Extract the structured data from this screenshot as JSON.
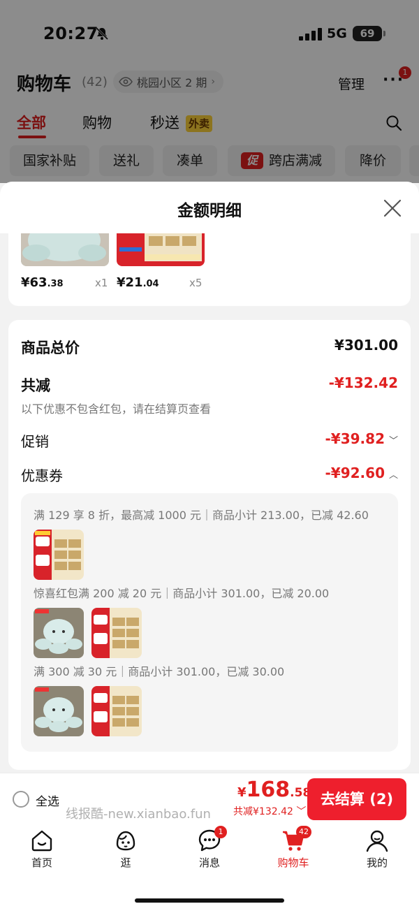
{
  "status": {
    "time": "20:27",
    "network": "5G",
    "battery": "69"
  },
  "header": {
    "title": "购物车",
    "count": "(42)",
    "location": "桃园小区 2 期",
    "manage": "管理",
    "more_badge": "1"
  },
  "tabs": [
    "全部",
    "购物",
    "秒送"
  ],
  "waimai_tag": "外卖",
  "chips": {
    "c1": "国家补贴",
    "c2": "送礼",
    "c3": "凑单",
    "c4_tag": "促",
    "c4": "跨店满减",
    "c5": "降价"
  },
  "sheet": {
    "title": "金额明细",
    "items": [
      {
        "price_int": "¥63",
        "price_dec": ".38",
        "qty": "x1"
      },
      {
        "price_int": "¥21",
        "price_dec": ".04",
        "qty": "x5"
      }
    ],
    "goods_total_label": "商品总价",
    "goods_total": "¥301.00",
    "reduce_label": "共减",
    "reduce_total": "-¥132.42",
    "note": "以下优惠不包含红包，请在结算页查看",
    "promo_label": "促销",
    "promo_value": "-¥39.82",
    "coupon_label": "优惠券",
    "coupon_value": "-¥92.60",
    "coupon_lines": [
      "满 129 享 8 折，最高减 1000 元｜商品小计 213.00，已减 42.60",
      "惊喜红包满 200 减 20 元｜商品小计 301.00，已减 20.00",
      "满 300 减 30 元｜商品小计 301.00，已减 30.00"
    ]
  },
  "checkout": {
    "select_all": "全选",
    "yen": "¥",
    "total_int": "168",
    "total_dec": ".58",
    "saved": "共减¥132.42",
    "pay_button": "去结算 (2)"
  },
  "watermark": "线报酷-new.xianbao.fun",
  "tabbar": [
    {
      "label": "首页"
    },
    {
      "label": "逛"
    },
    {
      "label": "消息",
      "badge": "1"
    },
    {
      "label": "购物车",
      "badge": "42"
    },
    {
      "label": "我的"
    }
  ],
  "colors": {
    "accent": "#e02020",
    "pay": "#ee1f2d",
    "waimai": "#ffd43a"
  }
}
